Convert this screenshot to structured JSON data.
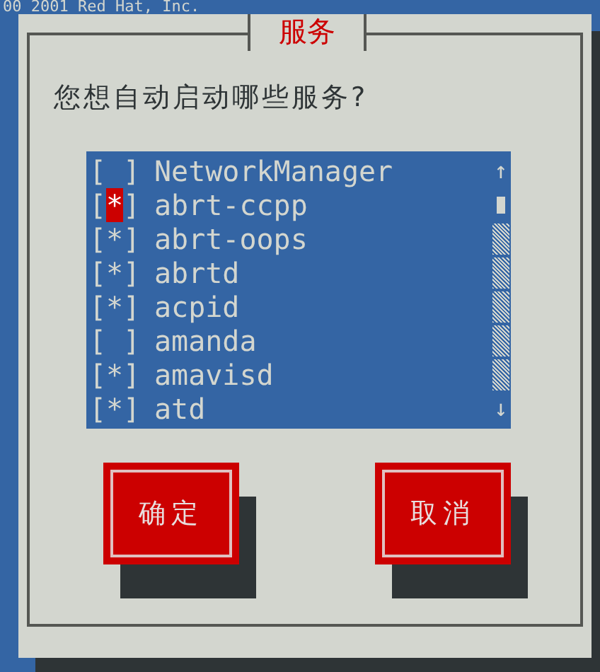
{
  "background_text": "00 2001 Red Hat, Inc.",
  "dialog": {
    "title": "服务",
    "prompt": "您想自动启动哪些服务?",
    "list": {
      "items": [
        {
          "label": "NetworkManager",
          "checked": false,
          "selected": false
        },
        {
          "label": "abrt-ccpp",
          "checked": true,
          "selected": true
        },
        {
          "label": "abrt-oops",
          "checked": true,
          "selected": false
        },
        {
          "label": "abrtd",
          "checked": true,
          "selected": false
        },
        {
          "label": "acpid",
          "checked": true,
          "selected": false
        },
        {
          "label": "amanda",
          "checked": false,
          "selected": false
        },
        {
          "label": "amavisd",
          "checked": true,
          "selected": false
        },
        {
          "label": "atd",
          "checked": true,
          "selected": false
        }
      ],
      "scroll_up": "↑",
      "scroll_down": "↓",
      "box_open": "[",
      "box_close": "]",
      "check_mark": "*"
    },
    "buttons": [
      {
        "label": "确定"
      },
      {
        "label": "取消"
      }
    ]
  }
}
